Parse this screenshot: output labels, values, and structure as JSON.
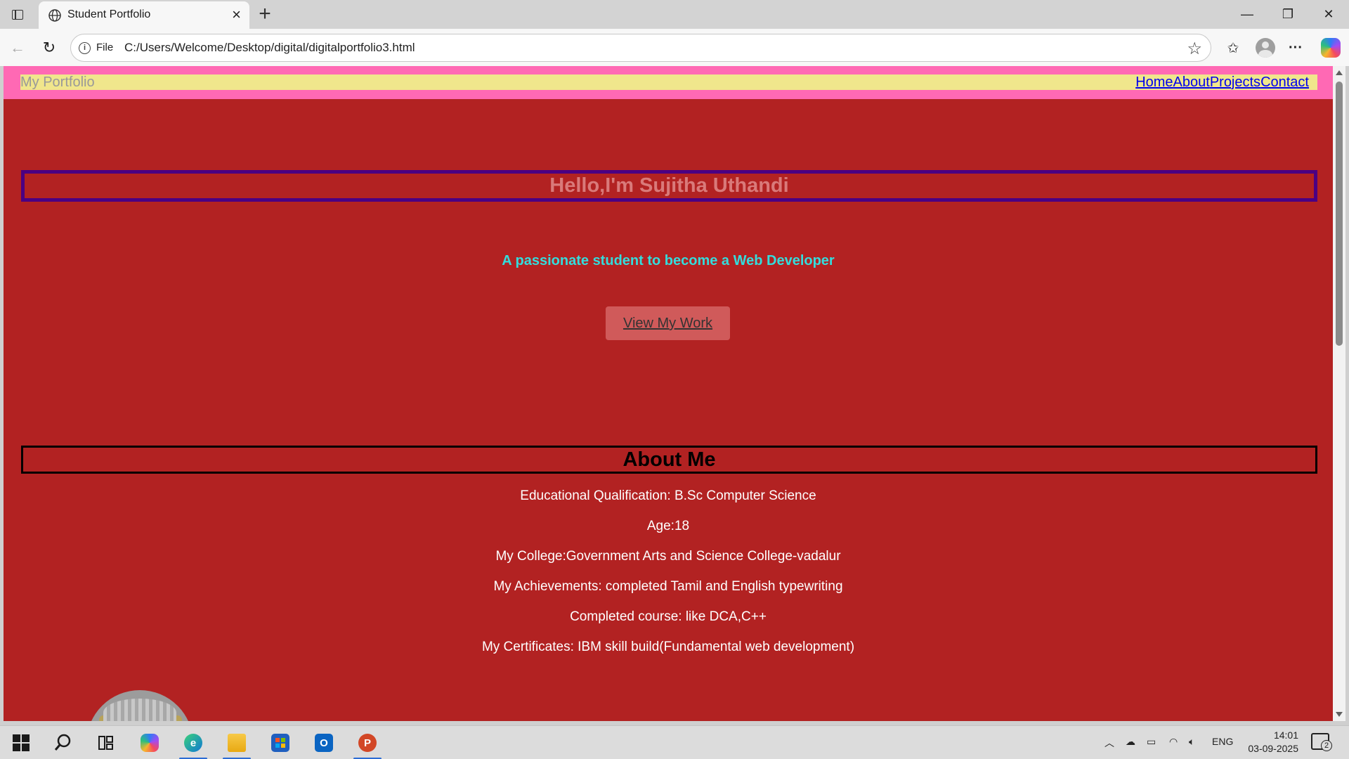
{
  "browser": {
    "tab_title": "Student Portfolio",
    "address_scheme_label": "File",
    "url": "C:/Users/Welcome/Desktop/digital/digitalportfolio3.html"
  },
  "site": {
    "brand": "My Portfolio",
    "nav": [
      "Home",
      "About",
      "Projects",
      "Contact"
    ],
    "hero_title": "Hello,I'm Sujitha Uthandi",
    "tagline": "A passionate student to become a Web Developer",
    "cta_label": "View My Work",
    "about_title": "About Me",
    "about_items": [
      "Educational Qualification: B.Sc Computer Science",
      "Age:18",
      "My College:Government Arts and Science College-vadalur",
      "My Achievements: completed Tamil and English typewriting",
      "Completed course: like DCA,C++",
      "My Certificates: IBM skill build(Fundamental web development)"
    ]
  },
  "taskbar": {
    "language": "ENG",
    "time": "14:01",
    "date": "03-09-2025",
    "notification_count": "2",
    "apps": [
      "start-icon",
      "search-icon",
      "task-view-icon",
      "copilot-icon",
      "edge-icon",
      "file-explorer-icon",
      "store-icon",
      "outlook-icon",
      "powerpoint-icon"
    ]
  },
  "colors": {
    "page_bg": "#b22222",
    "header_bg": "#ff69b4",
    "nav_bg": "#f0e68c",
    "hero_border": "#4b0082",
    "tagline": "#33dddd"
  }
}
